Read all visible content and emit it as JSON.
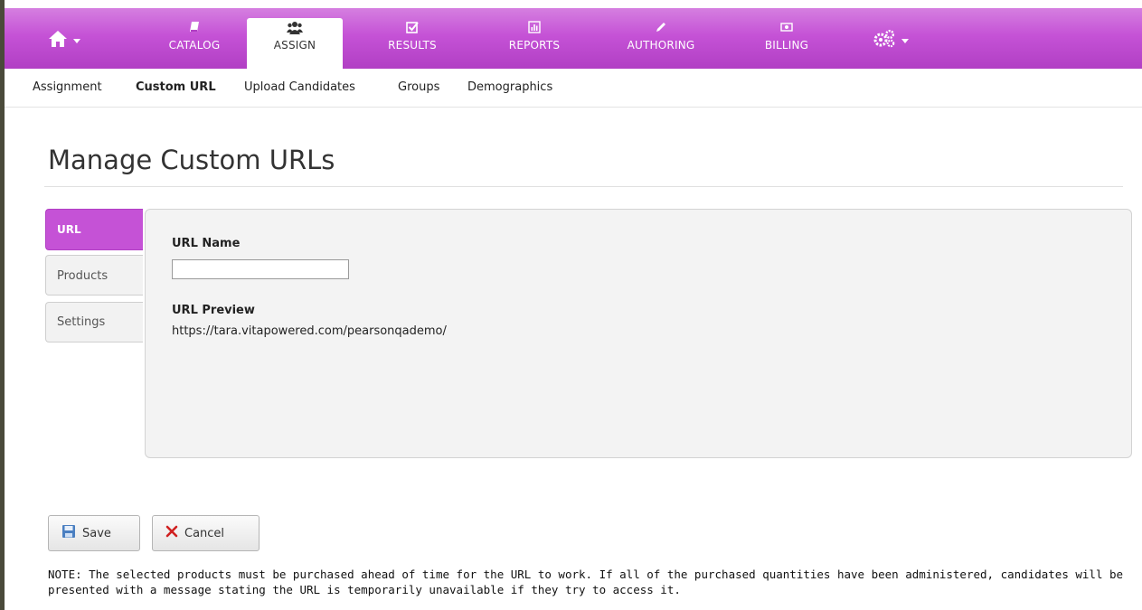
{
  "colors": {
    "accent": "#c552d6",
    "accent_dark": "#b13fc4"
  },
  "topnav": {
    "home_icon": "home-icon",
    "items": [
      {
        "label": "CATALOG",
        "icon": "book-icon"
      },
      {
        "label": "ASSIGN",
        "icon": "users-icon",
        "active": true
      },
      {
        "label": "RESULTS",
        "icon": "checkbox-icon"
      },
      {
        "label": "REPORTS",
        "icon": "bar-chart-icon"
      },
      {
        "label": "AUTHORING",
        "icon": "pencil-icon"
      },
      {
        "label": "BILLING",
        "icon": "money-icon"
      }
    ],
    "settings_icon": "gears-icon"
  },
  "subnav": {
    "items": [
      {
        "label": "Assignment"
      },
      {
        "label": "Custom URL",
        "active": true
      },
      {
        "label": "Upload Candidates"
      },
      {
        "label": "Groups"
      },
      {
        "label": "Demographics"
      }
    ]
  },
  "page": {
    "title": "Manage Custom URLs"
  },
  "tabs": [
    {
      "label": "URL",
      "active": true
    },
    {
      "label": "Products"
    },
    {
      "label": "Settings"
    }
  ],
  "form": {
    "url_name_label": "URL Name",
    "url_name_value": "",
    "url_preview_label": "URL Preview",
    "url_preview_value": "https://tara.vitapowered.com/pearsonqademo/"
  },
  "buttons": {
    "save_label": "Save",
    "cancel_label": "Cancel"
  },
  "note": "NOTE: The selected products must be purchased ahead of time for the URL to work. If all of the purchased quantities have been administered, candidates will be presented with a message stating the URL is temporarily unavailable if they try to access it."
}
